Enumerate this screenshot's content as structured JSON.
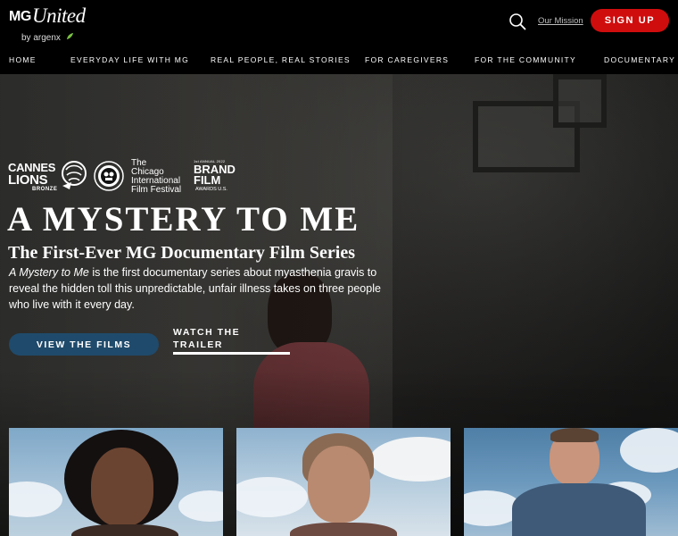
{
  "header": {
    "logo": {
      "mg": "MG",
      "united": "United",
      "byline": "by argenx"
    },
    "search_icon": "search-icon",
    "mission_link": "Our Mission",
    "signup_label": "SIGN UP",
    "signup_color": "#d00d0d"
  },
  "nav": {
    "items": [
      {
        "label": "HOME"
      },
      {
        "label": "EVERYDAY LIFE WITH MG"
      },
      {
        "label": "REAL PEOPLE, REAL STORIES"
      },
      {
        "label": "FOR CAREGIVERS"
      },
      {
        "label": "FOR THE COMMUNITY"
      },
      {
        "label": "DOCUMENTARY"
      }
    ]
  },
  "hero": {
    "awards": {
      "cannes": {
        "line1": "CANNES",
        "line2": "LIONS",
        "line3": "BRONZE"
      },
      "chicago": {
        "line1": "The",
        "line2": "Chicago",
        "line3": "International",
        "line4": "Film Festival"
      },
      "brand_film": {
        "line1": "1st ANNUAL 2022",
        "line2": "BRAND",
        "line3": "FILM",
        "line4": "AWARDS U.S."
      }
    },
    "title": "A MYSTERY TO ME",
    "subtitle": "The First-Ever MG Documentary Film Series",
    "description_italic": "A Mystery to Me",
    "description_rest": " is the first documentary series about myasthenia gravis to reveal the hidden toll this unpredictable, unfair illness takes on three people who live with it every day.",
    "view_films_label": "VIEW THE FILMS",
    "view_films_color": "#1f4a6b",
    "watch_trailer_line1": "WATCH THE",
    "watch_trailer_line2": "TRAILER"
  },
  "film_cards": [
    {
      "name": "film-card-1"
    },
    {
      "name": "film-card-2"
    },
    {
      "name": "film-card-3"
    }
  ]
}
